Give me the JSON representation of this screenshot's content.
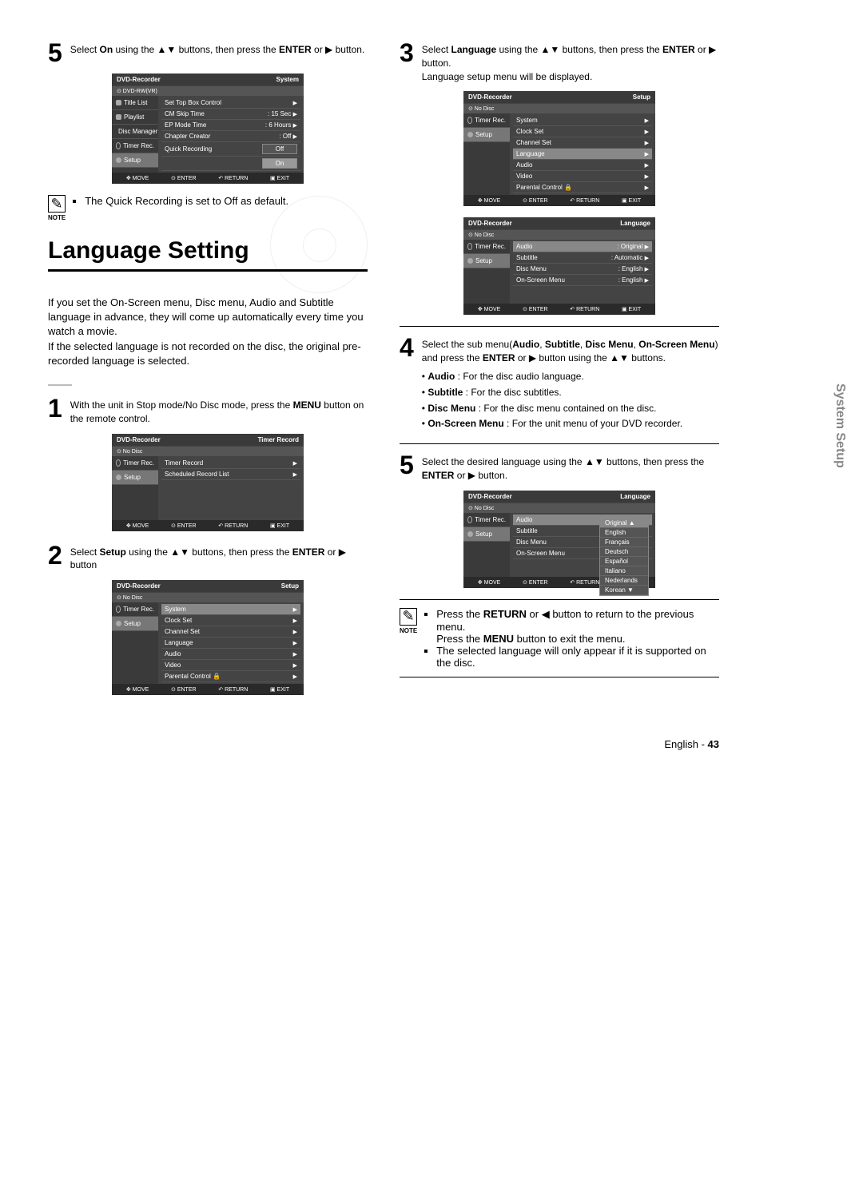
{
  "sideTab": "System Setup",
  "footer": {
    "lang": "English -",
    "page": "43"
  },
  "left": {
    "step5": {
      "num": "5",
      "text_a": "Select ",
      "bold1": "On",
      "text_b": " using the ▲▼ buttons, then press the ",
      "bold2": "ENTER",
      "text_c": " or ▶ button."
    },
    "osd1": {
      "title": "DVD-Recorder",
      "corner": "System",
      "sub": "DVD-RW(VR)",
      "side": [
        "Title List",
        "Playlist",
        "Disc Manager",
        "Timer Rec.",
        "Setup"
      ],
      "rows": [
        {
          "k": "Set Top Box Control",
          "v": "",
          "a": "▶"
        },
        {
          "k": "CM Skip Time",
          "v": ": 15 Sec",
          "a": "▶"
        },
        {
          "k": "EP Mode Time",
          "v": ": 6 Hours",
          "a": "▶"
        },
        {
          "k": "Chapter Creator",
          "v": ": Off",
          "a": "▶"
        },
        {
          "k": "Quick Recording",
          "v": "",
          "opts": [
            "Off",
            "On"
          ]
        }
      ],
      "foot": [
        "MOVE",
        "ENTER",
        "RETURN",
        "EXIT"
      ]
    },
    "note1": {
      "label": "NOTE",
      "text": "The Quick Recording is set to Off as default."
    },
    "sectionTitle": "Language Setting",
    "intro": "If you set the On-Screen menu, Disc menu, Audio and Subtitle language in advance, they will come up automatically every time you watch a movie.\nIf the selected language is not recorded on the disc, the original pre-recorded language is selected.",
    "step1": {
      "num": "1",
      "text_a": "With the unit in Stop mode/No Disc mode, press the ",
      "bold1": "MENU",
      "text_b": " button on the remote control."
    },
    "osd2": {
      "title": "DVD-Recorder",
      "corner": "Timer Record",
      "sub": "No Disc",
      "side": [
        "Timer Rec.",
        "Setup"
      ],
      "rows": [
        {
          "k": "Timer Record",
          "v": "",
          "a": "▶"
        },
        {
          "k": "Scheduled Record List",
          "v": "",
          "a": "▶"
        }
      ],
      "foot": [
        "MOVE",
        "ENTER",
        "RETURN",
        "EXIT"
      ]
    },
    "step2": {
      "num": "2",
      "text_a": "Select ",
      "bold1": "Setup",
      "text_b": " using the ▲▼ buttons, then press the ",
      "bold2": "ENTER",
      "text_c": " or ▶ button"
    },
    "osd3": {
      "title": "DVD-Recorder",
      "corner": "Setup",
      "sub": "No Disc",
      "side": [
        "Timer Rec.",
        "Setup"
      ],
      "rows": [
        {
          "k": "System",
          "v": "",
          "a": "▶",
          "hl": true
        },
        {
          "k": "Clock Set",
          "v": "",
          "a": "▶"
        },
        {
          "k": "Channel Set",
          "v": "",
          "a": "▶"
        },
        {
          "k": "Language",
          "v": "",
          "a": "▶"
        },
        {
          "k": "Audio",
          "v": "",
          "a": "▶"
        },
        {
          "k": "Video",
          "v": "",
          "a": "▶"
        },
        {
          "k": "Parental Control 🔒",
          "v": "",
          "a": "▶"
        }
      ],
      "foot": [
        "MOVE",
        "ENTER",
        "RETURN",
        "EXIT"
      ]
    }
  },
  "right": {
    "step3": {
      "num": "3",
      "text_a": "Select ",
      "bold1": "Language",
      "text_b": " using the ▲▼ buttons, then press the ",
      "bold2": "ENTER",
      "text_c": " or ▶ button.",
      "after": "Language setup menu will be displayed."
    },
    "osd4": {
      "title": "DVD-Recorder",
      "corner": "Setup",
      "sub": "No Disc",
      "side": [
        "Timer Rec.",
        "Setup"
      ],
      "rows": [
        {
          "k": "System",
          "v": "",
          "a": "▶"
        },
        {
          "k": "Clock Set",
          "v": "",
          "a": "▶"
        },
        {
          "k": "Channel Set",
          "v": "",
          "a": "▶"
        },
        {
          "k": "Language",
          "v": "",
          "a": "▶",
          "hl": true
        },
        {
          "k": "Audio",
          "v": "",
          "a": "▶"
        },
        {
          "k": "Video",
          "v": "",
          "a": "▶"
        },
        {
          "k": "Parental Control 🔒",
          "v": "",
          "a": "▶"
        }
      ],
      "foot": [
        "MOVE",
        "ENTER",
        "RETURN",
        "EXIT"
      ]
    },
    "osd5": {
      "title": "DVD-Recorder",
      "corner": "Language",
      "sub": "No Disc",
      "side": [
        "Timer Rec.",
        "Setup"
      ],
      "rows": [
        {
          "k": "Audio",
          "v": ": Original",
          "a": "▶",
          "hl": true
        },
        {
          "k": "Subtitle",
          "v": ": Automatic",
          "a": "▶"
        },
        {
          "k": "Disc Menu",
          "v": ": English",
          "a": "▶"
        },
        {
          "k": "On-Screen Menu",
          "v": ": English",
          "a": "▶"
        }
      ],
      "foot": [
        "MOVE",
        "ENTER",
        "RETURN",
        "EXIT"
      ]
    },
    "step4": {
      "num": "4",
      "text_a": "Select the sub menu(",
      "bold1": "Audio",
      "sep": ", ",
      "bold2": "Subtitle",
      "bold3": "Disc Menu",
      "bold4": "On-Screen Menu",
      "text_b": ") and press the ",
      "bold5": "ENTER",
      "text_c": " or ▶ button using the ▲▼ buttons.",
      "bullets": [
        {
          "k": "Audio",
          "v": " : For the disc audio language."
        },
        {
          "k": "Subtitle",
          "v": " : For the disc subtitles."
        },
        {
          "k": "Disc Menu",
          "v": " : For the disc menu contained on the disc."
        },
        {
          "k": "On-Screen Menu",
          "v": " : For the unit menu of your DVD recorder."
        }
      ]
    },
    "step5r": {
      "num": "5",
      "text_a": "Select the desired language using the ▲▼ buttons, then press the ",
      "bold1": "ENTER",
      "text_b": " or ▶ button."
    },
    "osd6": {
      "title": "DVD-Recorder",
      "corner": "Language",
      "sub": "No Disc",
      "side": [
        "Timer Rec.",
        "Setup"
      ],
      "rows": [
        {
          "k": "Audio",
          "dd": [
            "Original",
            "English",
            "Français",
            "Deutsch",
            "Español",
            "Italiano",
            "Nederlands",
            "Korean"
          ],
          "sel": 0,
          "hl": true
        },
        {
          "k": "Subtitle"
        },
        {
          "k": "Disc Menu"
        },
        {
          "k": "On-Screen Menu"
        }
      ],
      "foot": [
        "MOVE",
        "ENTER",
        "RETURN",
        "EXIT"
      ]
    },
    "note2": {
      "label": "NOTE",
      "items": [
        "Press the <b>RETURN</b> or ◀ button to return to the previous menu.<br>Press the <b>MENU</b> button to exit the menu.",
        "The selected language will only appear if it is supported on the disc."
      ]
    }
  }
}
